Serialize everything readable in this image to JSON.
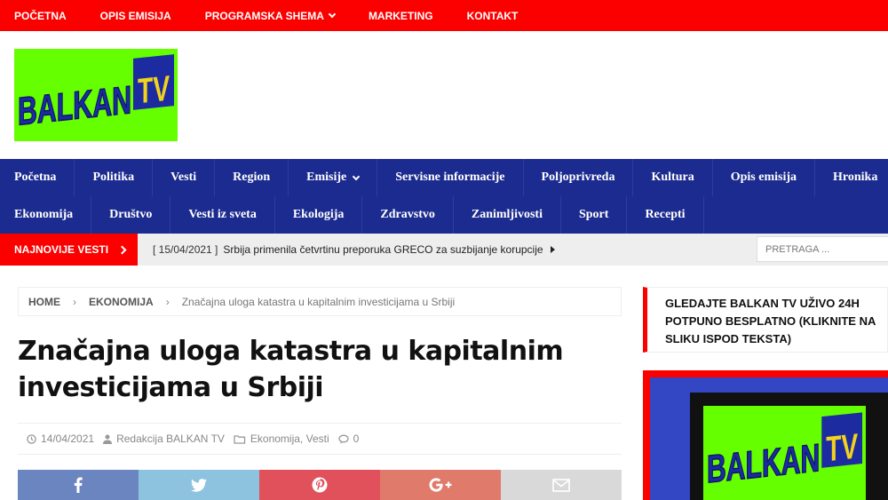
{
  "topnav": {
    "items": [
      "Početna",
      "Opis emisija",
      "Programska shema",
      "Marketing",
      "Kontakt"
    ]
  },
  "logo": {
    "text_balkan": "BALKAN",
    "text_tv": "TV"
  },
  "mainnav": {
    "row1": [
      "Početna",
      "Politika",
      "Vesti",
      "Region",
      "Emisije",
      "Servisne informacije",
      "Poljoprivreda",
      "Kultura",
      "Opis emisija",
      "Hronika"
    ],
    "row2": [
      "Ekonomija",
      "Društvo",
      "Vesti iz sveta",
      "Ekologija",
      "Zdravstvo",
      "Zanimljivosti",
      "Sport",
      "Recepti"
    ]
  },
  "ticker": {
    "label": "NAJNOVIJE VESTI",
    "date": "[ 15/04/2021 ]",
    "headline": "Srbija primenila četvrtinu preporuka GRECO za suzbijanje korupcije"
  },
  "search": {
    "placeholder": "PRETRAGA ..."
  },
  "breadcrumb": {
    "home": "HOME",
    "category": "EKONOMIJA",
    "current": "Značajna uloga katastra u kapitalnim investicijama u Srbiji"
  },
  "article": {
    "title_line1": "Značajna uloga katastra u kapitalnim",
    "title_line2": "investicijama u Srbiji",
    "date": "14/04/2021",
    "author": "Redakcija BALKAN TV",
    "categories": "Ekonomija, Vesti",
    "comments": "0"
  },
  "share": {
    "buttons": [
      "facebook-icon",
      "twitter-icon",
      "pinterest-icon",
      "google-plus-icon",
      "email-icon"
    ],
    "colors": [
      "#6b85c0",
      "#8ec3df",
      "#e0515b",
      "#e07a6b",
      "#d9d9d9"
    ]
  },
  "sidebar": {
    "heading_line1": "GLEDAJTE BALKAN TV UŽIVO 24H",
    "heading_line2": "POTPUNO BESPLATNO (KLIKNITE NA",
    "heading_line3": "SLIKU ISPOD TEKSTA)"
  },
  "colors": {
    "red": "#fc0000",
    "navy": "#1c2b8f",
    "logo_green": "#66ff00",
    "logo_blue": "#1c2ca0",
    "logo_yellow": "#f2d21d"
  }
}
